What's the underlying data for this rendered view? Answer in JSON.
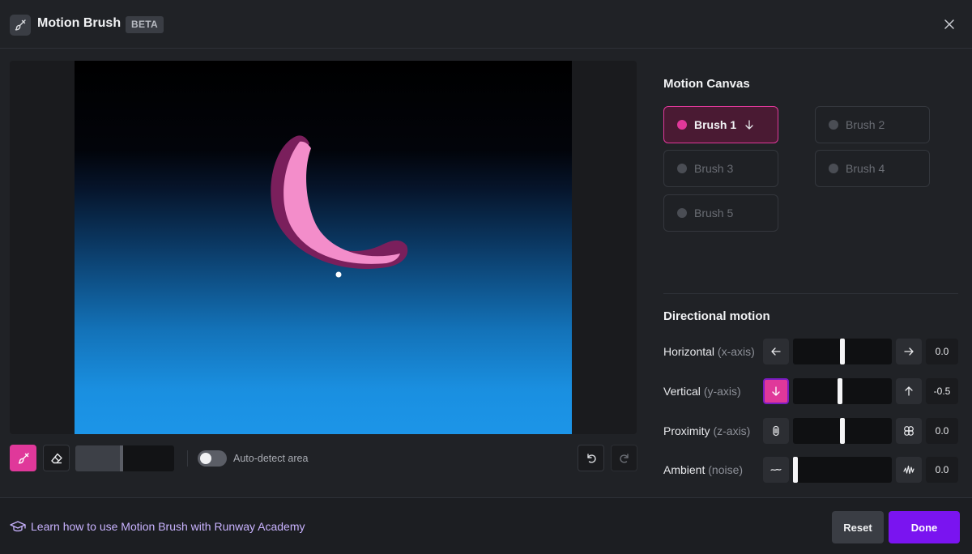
{
  "header": {
    "title": "Motion Brush",
    "badge": "BETA",
    "icon": "brush-icon"
  },
  "toolbar": {
    "brush_size_percent": 47,
    "auto_detect_label": "Auto-detect area",
    "auto_detect_on": false
  },
  "motion_canvas": {
    "title": "Motion Canvas",
    "brushes": [
      {
        "label": "Brush 1",
        "active": true,
        "direction_icon": "arrow-down-icon"
      },
      {
        "label": "Brush 2",
        "active": false
      },
      {
        "label": "Brush 3",
        "active": false
      },
      {
        "label": "Brush 4",
        "active": false
      },
      {
        "label": "Brush 5",
        "active": false
      }
    ]
  },
  "directional_motion": {
    "title": "Directional motion",
    "rows": [
      {
        "name": "Horizontal",
        "axis": "(x-axis)",
        "value": "0.0",
        "level": 0.5,
        "left_icon": "arrow-left-icon",
        "right_icon": "arrow-right-icon"
      },
      {
        "name": "Vertical",
        "axis": "(y-axis)",
        "value": "-0.5",
        "level": 0.475,
        "left_icon": "arrow-down-icon",
        "right_icon": "arrow-up-icon"
      },
      {
        "name": "Proximity",
        "axis": "(z-axis)",
        "value": "0.0",
        "level": 0.5,
        "left_icon": "shrink-icon",
        "right_icon": "expand-icon"
      },
      {
        "name": "Ambient",
        "axis": "(noise)",
        "value": "0.0",
        "level": 0.0,
        "left_icon": "low-noise-icon",
        "right_icon": "high-noise-icon"
      }
    ]
  },
  "footer": {
    "learn_link": "Learn how to use Motion Brush with Runway Academy",
    "reset_label": "Reset",
    "done_label": "Done"
  },
  "colors": {
    "accent_pink": "#e0389a",
    "primary_purple": "#7a14f0"
  }
}
